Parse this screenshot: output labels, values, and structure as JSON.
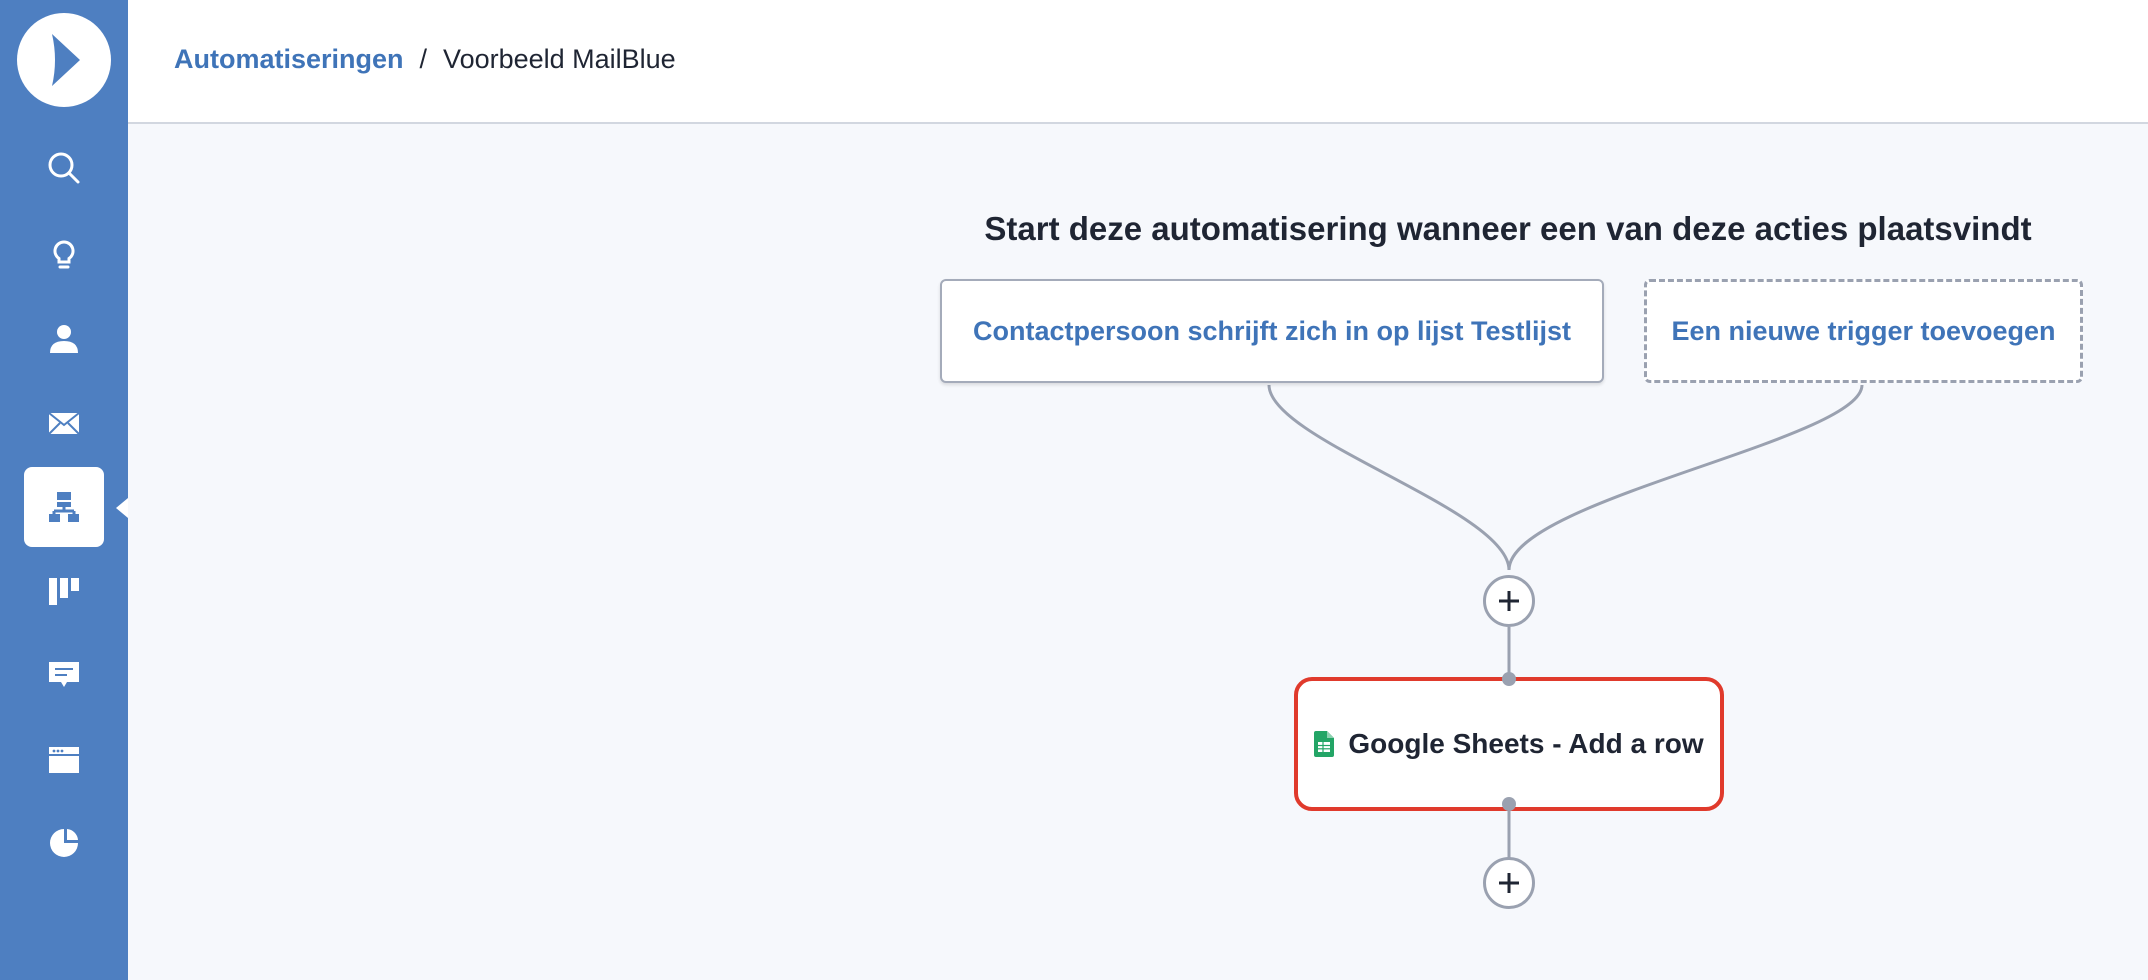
{
  "sidebar": {
    "items": [
      {
        "icon": "search-icon"
      },
      {
        "icon": "lightbulb-icon"
      },
      {
        "icon": "contacts-icon"
      },
      {
        "icon": "envelope-icon"
      },
      {
        "icon": "automation-icon",
        "active": true
      },
      {
        "icon": "pipeline-icon"
      },
      {
        "icon": "chat-icon"
      },
      {
        "icon": "website-icon"
      },
      {
        "icon": "reports-icon"
      }
    ]
  },
  "breadcrumb": {
    "link": "Automatiseringen",
    "separator": "/",
    "current": "Voorbeeld MailBlue"
  },
  "flow": {
    "heading": "Start deze automatisering wanneer een van deze acties plaatsvindt",
    "triggers": [
      {
        "label": "Contactpersoon schrijft zich in op lijst Testlijst"
      },
      {
        "label": "Een nieuwe trigger toevoegen"
      }
    ],
    "action": {
      "label": "Google Sheets - Add a row",
      "icon": "google-sheets-icon"
    }
  },
  "colors": {
    "sidebar": "#4e7fc1",
    "link": "#3f74b8",
    "highlight": "#e03a2c",
    "connector": "#9aa1b0"
  }
}
